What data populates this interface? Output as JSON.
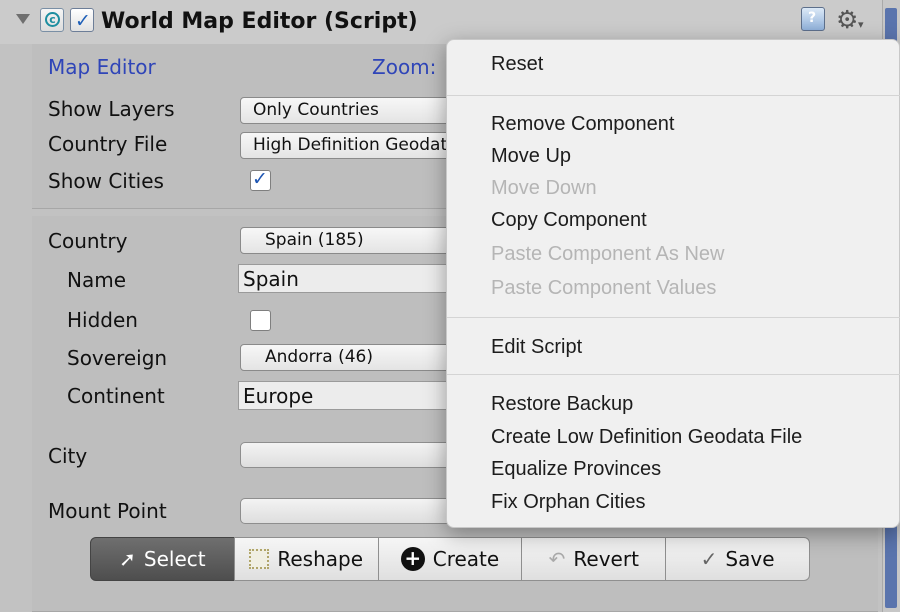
{
  "header": {
    "title": "World Map Editor (Script)",
    "enabled": true
  },
  "panel1": {
    "heading": "Map Editor",
    "zoom_label": "Zoom:",
    "show_layers_label": "Show Layers",
    "show_layers_value": "Only Countries",
    "country_file_label": "Country File",
    "country_file_value": "High Definition Geodata File",
    "show_cities_label": "Show Cities",
    "show_cities_checked": true
  },
  "panel2": {
    "country_label": "Country",
    "country_value": "Spain (185)",
    "name_label": "Name",
    "name_value": "Spain",
    "hidden_label": "Hidden",
    "hidden_checked": false,
    "sovereign_label": "Sovereign",
    "sovereign_value": "Andorra (46)",
    "continent_label": "Continent",
    "continent_value": "Europe",
    "city_label": "City",
    "mount_point_label": "Mount Point"
  },
  "toolbar": {
    "buttons": [
      {
        "label": "Select",
        "icon": "cursor-icon",
        "active": true
      },
      {
        "label": "Reshape",
        "icon": "reshape-icon",
        "active": false
      },
      {
        "label": "Create",
        "icon": "plus-circle-icon",
        "active": false
      },
      {
        "label": "Revert",
        "icon": "undo-arrow-icon",
        "active": false
      },
      {
        "label": "Save",
        "icon": "checkmark-icon",
        "active": false
      }
    ]
  },
  "context_menu": {
    "items": [
      {
        "label": "Reset",
        "enabled": true
      },
      {
        "label": "Remove Component",
        "enabled": true
      },
      {
        "label": "Move Up",
        "enabled": true
      },
      {
        "label": "Move Down",
        "enabled": false
      },
      {
        "label": "Copy Component",
        "enabled": true
      },
      {
        "label": "Paste Component As New",
        "enabled": false
      },
      {
        "label": "Paste Component Values",
        "enabled": false
      },
      {
        "label": "Edit Script",
        "enabled": true
      },
      {
        "label": "Restore Backup",
        "enabled": true
      },
      {
        "label": "Create Low Definition Geodata File",
        "enabled": true
      },
      {
        "label": "Equalize Provinces",
        "enabled": true
      },
      {
        "label": "Fix Orphan Cities",
        "enabled": true
      }
    ]
  },
  "colors": {
    "accent": "#2f45b8",
    "checkbox_blue": "#1e56b3",
    "scrollbar_thumb": "#5a74ad",
    "menu_bg": "#f0f0f0",
    "menu_disabled": "#b5b5b5"
  }
}
